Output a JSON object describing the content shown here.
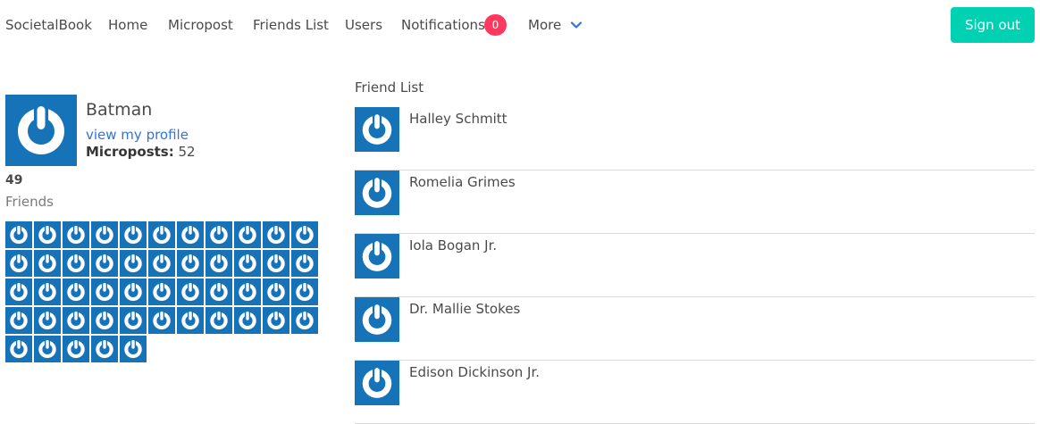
{
  "nav": {
    "brand": "SocietalBook",
    "home": "Home",
    "micropost": "Micropost",
    "friends_list": "Friends List",
    "users": "Users",
    "notifications": "Notifications",
    "notifications_count": "0",
    "more": "More",
    "sign_out": "Sign out"
  },
  "profile": {
    "name": "Batman",
    "view_profile": "view my profile",
    "microposts_label": "Microposts:",
    "microposts_count": "52",
    "friends_count": "49",
    "friends_label": "Friends"
  },
  "friend_grid_count": 49,
  "friend_list": {
    "title": "Friend List",
    "items": [
      {
        "name": "Halley Schmitt"
      },
      {
        "name": "Romelia Grimes"
      },
      {
        "name": "Iola Bogan Jr."
      },
      {
        "name": "Dr. Mallie Stokes"
      },
      {
        "name": "Edison Dickinson Jr."
      }
    ]
  },
  "colors": {
    "accent": "#00d1b2",
    "link": "#3273dc",
    "badge": "#ff3860",
    "avatar_bg": "#1673b8"
  },
  "icons": {
    "avatar": "gravatar-power-icon",
    "more": "chevron-down-icon"
  }
}
